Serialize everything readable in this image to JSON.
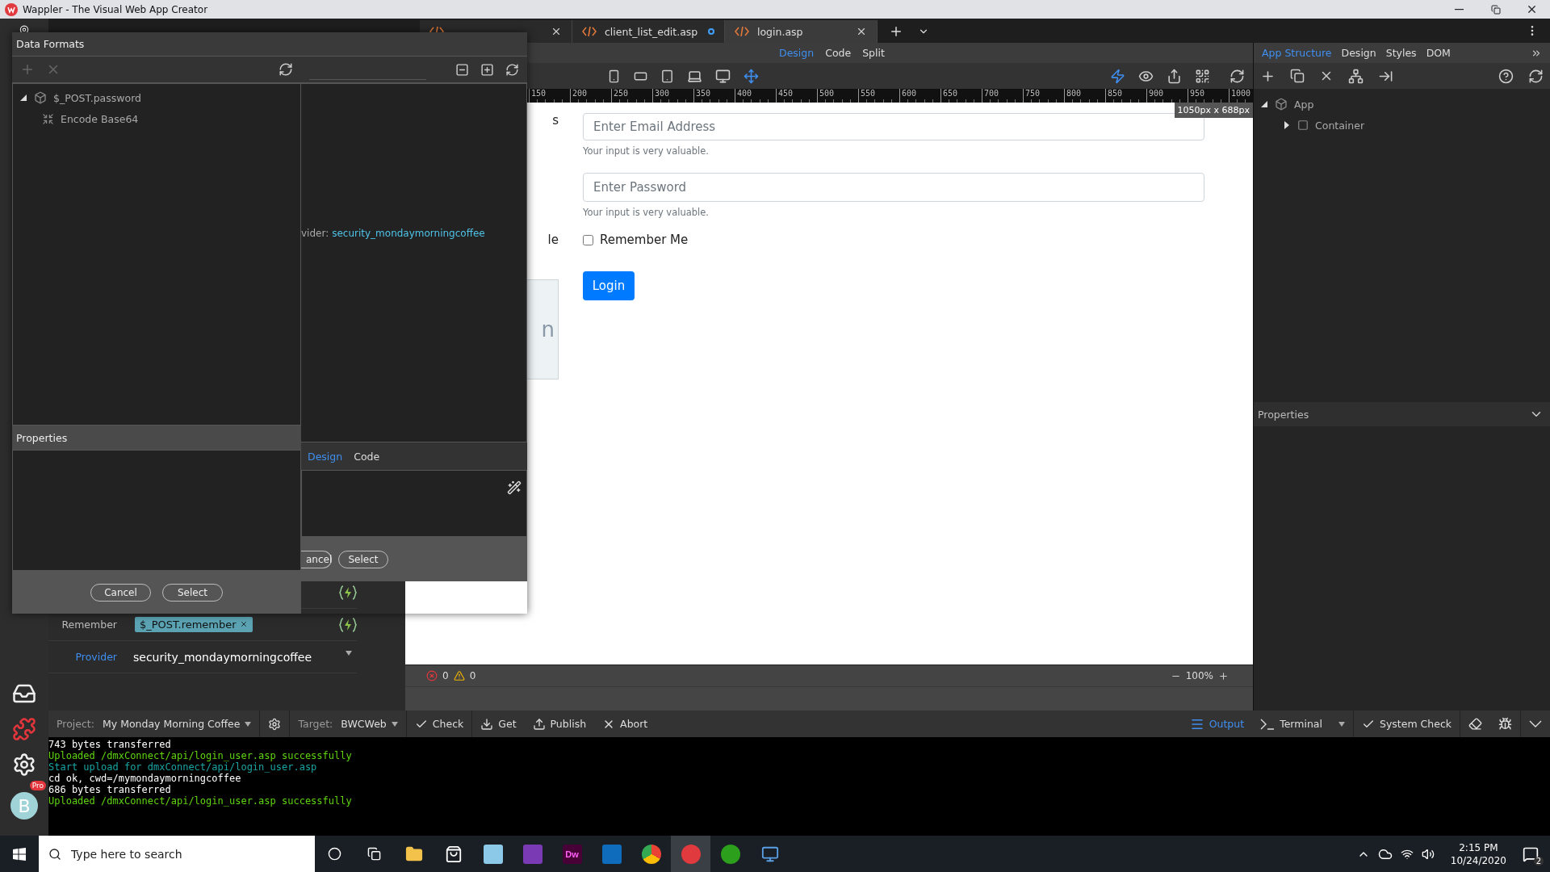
{
  "window": {
    "title": "Wappler - The Visual Web App Creator"
  },
  "tabs": [
    {
      "selected": false,
      "modified": false
    },
    {
      "label": "client_list_edit.asp",
      "selected": false,
      "modified": true
    },
    {
      "label": "login.asp",
      "selected": true,
      "modified": false
    }
  ],
  "view_tabs": [
    {
      "label": "Design",
      "selected": true
    },
    {
      "label": "Code",
      "selected": false
    },
    {
      "label": "Split",
      "selected": false
    }
  ],
  "panel_tabs": [
    {
      "label": "App Structure",
      "selected": true
    },
    {
      "label": "Design",
      "selected": false
    },
    {
      "label": "Styles",
      "selected": false
    },
    {
      "label": "DOM",
      "selected": false
    }
  ],
  "ruler": [
    "150",
    "200",
    "250",
    "300",
    "350",
    "400",
    "450",
    "500",
    "550",
    "600",
    "650",
    "700",
    "750",
    "800",
    "850",
    "900",
    "950",
    "1000"
  ],
  "canvas": {
    "size_badge": "1050px x 688px",
    "side_fragments": [
      "s",
      "le"
    ],
    "side_box_text": "n",
    "email": {
      "placeholder": "Enter Email Address",
      "help": "Your input is very valuable."
    },
    "password": {
      "placeholder": "Enter Password",
      "help": "Your input is very valuable."
    },
    "remember": {
      "label": "Remember Me",
      "checked": false
    },
    "login_button": "Login"
  },
  "status": {
    "errors": "0",
    "warnings": "0",
    "zoom": "100%"
  },
  "structure": {
    "items": [
      {
        "label": "App",
        "expanded": true,
        "children": [
          {
            "label": "Container",
            "expanded": false
          }
        ]
      }
    ],
    "properties_title": "Properties"
  },
  "action_properties": [
    {
      "label": "Remember",
      "value": "$_POST.remember",
      "kind": "tag"
    },
    {
      "label": "Provider",
      "value": "security_mondaymorningcoffee",
      "kind": "select"
    }
  ],
  "dialog": {
    "title": "Data Formats",
    "tree": [
      {
        "label": "$_POST.password",
        "expanded": true,
        "children": [
          {
            "label": "Encode Base64"
          }
        ]
      }
    ],
    "properties_title": "Properties",
    "buttons": [
      "Cancel",
      "Select"
    ],
    "back": {
      "provider_label": "vider:",
      "provider_value": "security_mondaymorningcoffee",
      "tabs": [
        {
          "label": "Design",
          "selected": true
        },
        {
          "label": "Code",
          "selected": false
        }
      ],
      "buttons": [
        "ancel",
        "Select"
      ]
    }
  },
  "bottom_bar": {
    "project_label": "Project:",
    "project": "My Monday Morning Coffee",
    "target_label": "Target:",
    "target": "BWCWeb",
    "actions": [
      "Check",
      "Get",
      "Publish",
      "Abort"
    ],
    "panels": [
      {
        "label": "Output",
        "selected": true
      },
      {
        "label": "Terminal",
        "selected": false
      }
    ],
    "system_check": "System Check"
  },
  "output": [
    {
      "text": "743 bytes transferred",
      "color": "#ffffff"
    },
    {
      "text": "Uploaded /dmxConnect/api/login_user.asp successfully",
      "color": "#5fd40f"
    },
    {
      "text": "Start upload for dmxConnect/api/login_user.asp",
      "color": "#1aa3a3"
    },
    {
      "text": "cd ok, cwd=/mymondaymorningcoffee",
      "color": "#ffffff"
    },
    {
      "text": "686 bytes transferred",
      "color": "#ffffff"
    },
    {
      "text": "Uploaded /dmxConnect/api/login_user.asp successfully",
      "color": "#5fd40f"
    }
  ],
  "user": {
    "initial": "B",
    "badge": "Pro"
  },
  "taskbar": {
    "search_placeholder": "Type here to search",
    "dw_label": "Dw",
    "time": "2:15 PM",
    "date": "10/24/2020",
    "notifications": "2"
  }
}
